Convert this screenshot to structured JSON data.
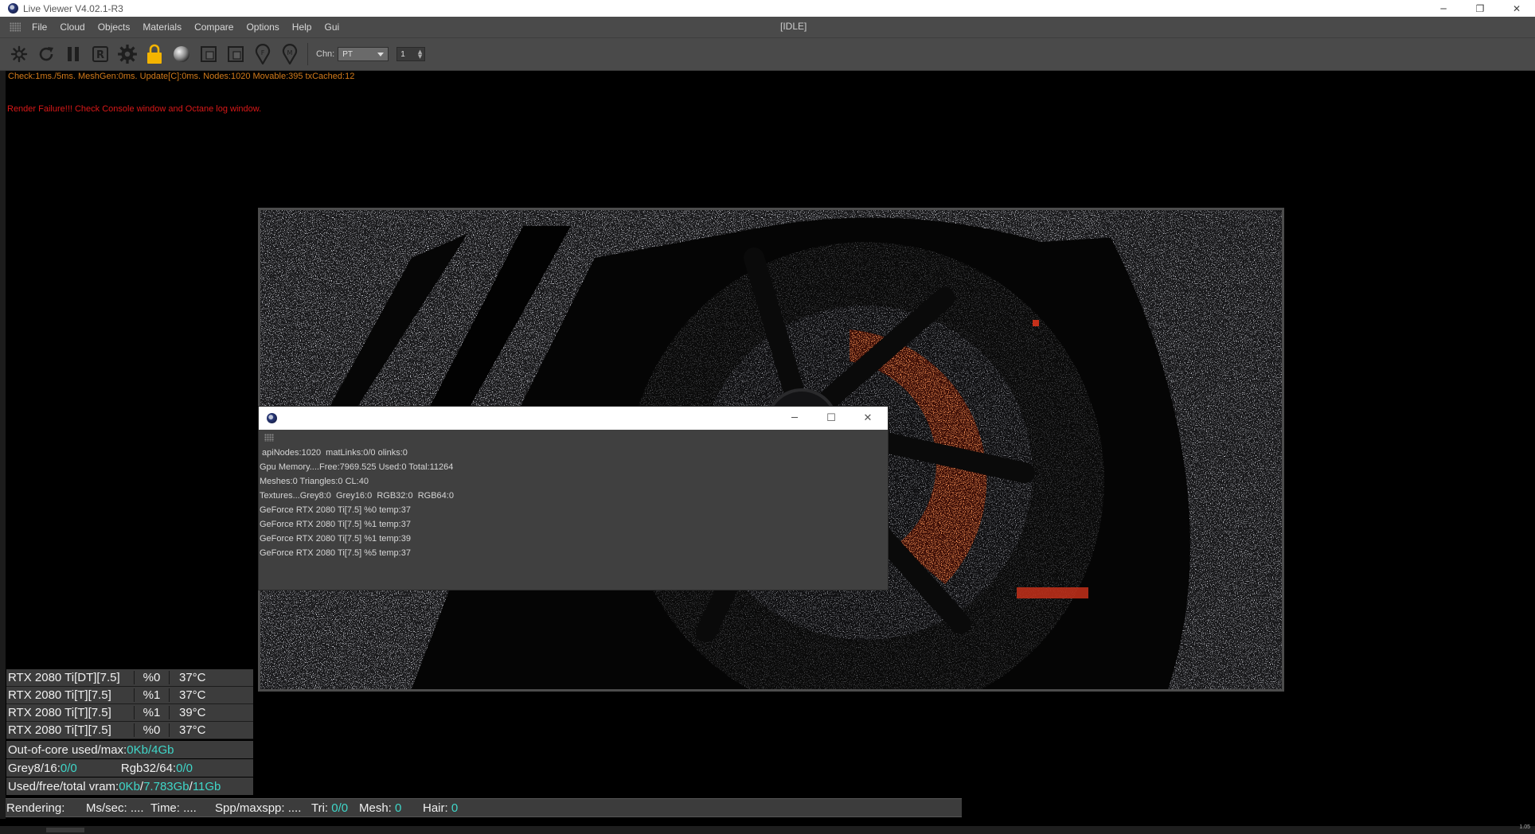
{
  "window": {
    "title": "Live Viewer V4.02.1-R3",
    "controls": {
      "minimize": "─",
      "maximize": "❐",
      "close": "✕"
    }
  },
  "menubar": {
    "items": [
      "File",
      "Cloud",
      "Objects",
      "Materials",
      "Compare",
      "Options",
      "Help",
      "Gui"
    ],
    "state": "[IDLE]"
  },
  "toolbar": {
    "icons": [
      "settings-burst-icon",
      "refresh-icon",
      "pause-icon",
      "r-icon",
      "gear-icon",
      "lock-icon",
      "sphere-icon",
      "region-icon",
      "region-alt-icon",
      "pin-f-icon",
      "pin-m-icon"
    ],
    "channel_label": "Chn:",
    "channel_value": "PT",
    "spin_value": "1",
    "accent_color": "#f4b400"
  },
  "status": {
    "stats": "Check:1ms./5ms. MeshGen:0ms. Update[C]:0ms. Nodes:1020 Movable:395 txCached:12",
    "stats_color": "#d27a1a",
    "failure": "Render Failure!!! Check Console window and Octane log window.",
    "failure_color": "#d81818"
  },
  "dialog": {
    "controls": {
      "minimize": "─",
      "maximize": "☐",
      "close": "✕"
    },
    "lines": [
      " apiNodes:1020  matLinks:0/0 olinks:0",
      "Gpu Memory....Free:7969.525 Used:0 Total:11264",
      "Meshes:0 Triangles:0 CL:40",
      "Textures...Grey8:0  Grey16:0  RGB32:0  RGB64:0",
      "GeForce RTX 2080 Ti[7.5] %0 temp:37",
      "GeForce RTX 2080 Ti[7.5] %1 temp:37",
      "GeForce RTX 2080 Ti[7.5] %1 temp:39",
      "GeForce RTX 2080 Ti[7.5] %5 temp:37"
    ]
  },
  "gpus": [
    {
      "name": "RTX 2080 Ti[DT][7.5]",
      "load": "%0",
      "temp": "37°C"
    },
    {
      "name": "RTX 2080 Ti[T][7.5]",
      "load": "%1",
      "temp": "37°C"
    },
    {
      "name": "RTX 2080 Ti[T][7.5]",
      "load": "%1",
      "temp": "39°C"
    },
    {
      "name": "RTX 2080 Ti[T][7.5]",
      "load": "%0",
      "temp": "37°C"
    }
  ],
  "memory": {
    "ooc_label": "Out-of-core used/max:",
    "ooc_used": "0Kb",
    "ooc_sep": "/",
    "ooc_max": "4Gb",
    "grey_label": "Grey8/16: ",
    "grey_value": "0/0",
    "rgb_label": "Rgb32/64: ",
    "rgb_value": "0/0",
    "vram_label": "Used/free/total vram: ",
    "vram_used": "0Kb",
    "vram_free": "7.783Gb",
    "vram_total": "11Gb",
    "vram_sep": "/",
    "value_color": "#3fd6c8"
  },
  "render_bar": {
    "rendering_label": "Rendering:",
    "ms_label": "Ms/sec: ",
    "ms_value": "....",
    "time_label": "Time: ",
    "time_value": "....",
    "spp_label": "Spp/maxspp: ",
    "spp_value": "....",
    "tri_label": "Tri: ",
    "tri_value": "0/0",
    "mesh_label": "Mesh: ",
    "mesh_value": "0",
    "hair_label": "Hair: ",
    "hair_value": "0"
  },
  "corner_text": "1.05"
}
